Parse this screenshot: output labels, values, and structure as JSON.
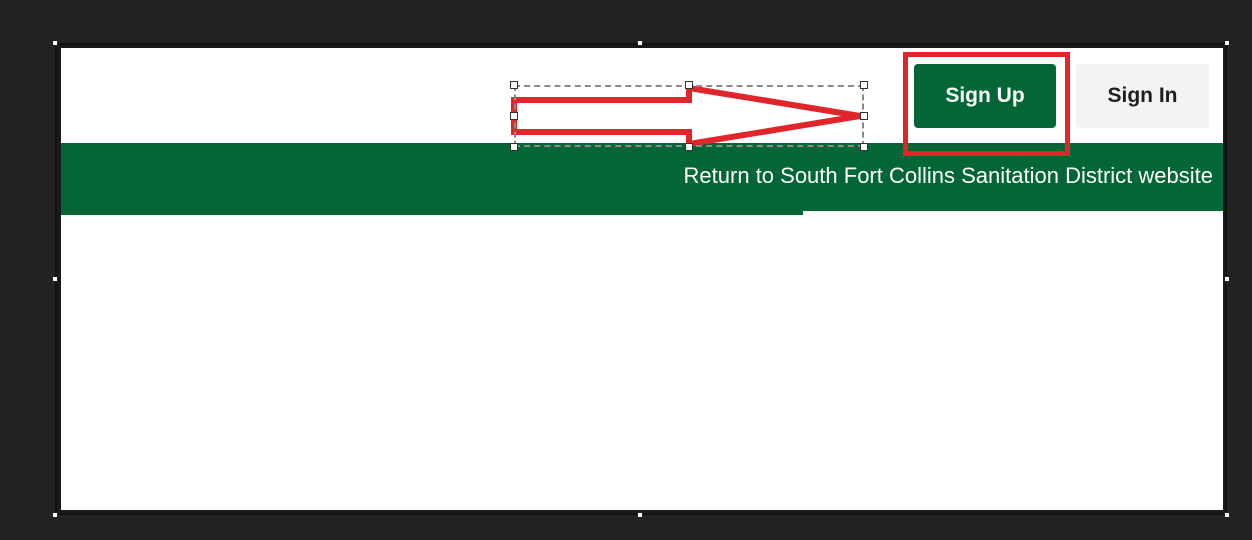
{
  "header": {
    "signup_label": "Sign Up",
    "signin_label": "Sign In"
  },
  "banner": {
    "link_text": "Return to South Fort Collins Sanitation District website"
  },
  "colors": {
    "brand_green": "#026637",
    "annotation_red": "#e0262b",
    "canvas_dark": "#222222"
  },
  "annotations": {
    "arrow": "right-arrow-icon",
    "highlight": "red rectangle around Sign Up"
  }
}
